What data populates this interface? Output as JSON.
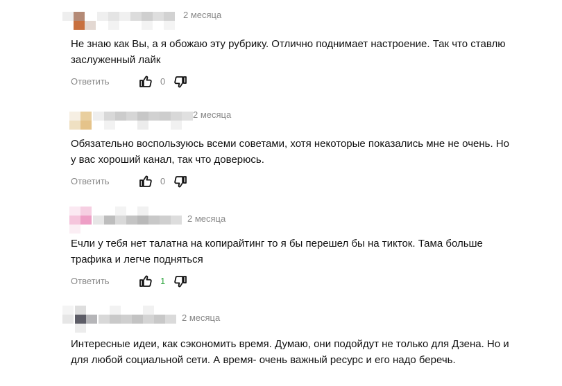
{
  "comments": [
    {
      "date": "2 месяца",
      "text": "Не знаю как Вы, а я обожаю эту рубрику. Отлично поднимает настроение. Так что ставлю заслуженный лайк",
      "reply_label": "Ответить",
      "likes": "0",
      "avatar_color": "#c8703f"
    },
    {
      "date": "2 месяца",
      "text": "Обязательно воспользуюсь всеми советами, хотя некоторые показались мне не очень. Но у вас хороший канал, так что доверюсь.",
      "reply_label": "Ответить",
      "likes": "0",
      "avatar_color": "#e5c38a"
    },
    {
      "date": "2 месяца",
      "text": "Ечли у тебя нет талатна на копирайтинг то я бы перешел бы на тикток. Тама больше трафика и легче подняться",
      "reply_label": "Ответить",
      "likes": "1",
      "avatar_color": "#ee9fc6"
    },
    {
      "date": "2 месяца",
      "text": "Интересные идеи, как сэкономить время. Думаю, они подойдут не только для Дзена. Но и для любой социальной сети. А время- очень важный ресурс и его надо беречь.",
      "avatar_color": "#5d5d67"
    }
  ],
  "colors": {
    "muted": "#888888",
    "positive": "#2aa33b",
    "text": "#111111"
  },
  "icons": [
    "thumbs-up-icon",
    "thumbs-down-icon"
  ]
}
